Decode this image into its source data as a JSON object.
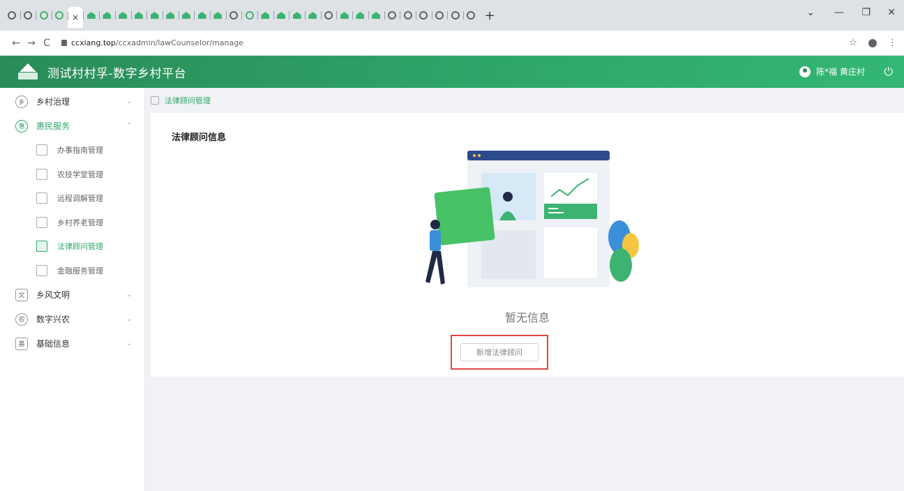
{
  "browser": {
    "tab_close": "×",
    "new_tab": "+",
    "url_host": "ccxiang.top",
    "url_path": "/ccxadmin/lawCounselor/manage",
    "nav_back": "←",
    "nav_forward": "→",
    "nav_reload": "C",
    "star": "☆",
    "menu": "⋮",
    "win_dropdown": "⌄",
    "win_min": "—",
    "win_restore": "❐",
    "win_close": "✕",
    "tabs": [
      "globe",
      "globe",
      "green",
      "green",
      "close",
      "house",
      "house",
      "house",
      "house",
      "house",
      "house",
      "house",
      "house",
      "house",
      "globe",
      "green",
      "house",
      "house",
      "house",
      "house",
      "globe",
      "house",
      "house",
      "house",
      "globe",
      "globe",
      "globe",
      "globe",
      "globe",
      "globe"
    ]
  },
  "header": {
    "title": "测试村村孚-数字乡村平台",
    "user_text": "陈*福 黄庄村",
    "power_icon": "power-icon"
  },
  "sidebar": {
    "items": [
      {
        "label": "乡村治理",
        "icon": "乡",
        "arrow": "⌄"
      },
      {
        "label": "惠民服务",
        "icon": "惠",
        "arrow": "⌃"
      }
    ],
    "sub_items": [
      {
        "label": "办事指南管理"
      },
      {
        "label": "农技学堂管理"
      },
      {
        "label": "远程调解管理"
      },
      {
        "label": "乡村养老管理"
      },
      {
        "label": "法律顾问管理"
      },
      {
        "label": "金融服务管理"
      }
    ],
    "items_after": [
      {
        "label": "乡风文明",
        "icon": "文",
        "arrow": "⌄"
      },
      {
        "label": "数字兴农",
        "icon": "农",
        "arrow": "⌄"
      },
      {
        "label": "基础信息",
        "icon": "基",
        "arrow": "⌄"
      }
    ]
  },
  "breadcrumb": {
    "label": "法律顾问管理"
  },
  "main": {
    "title": "法律顾问信息",
    "empty_text": "暂无信息",
    "add_button": "新增法律顾问"
  },
  "colors": {
    "accent": "#2fa86a",
    "header_start": "#2a8c59",
    "header_end": "#34b774",
    "highlight_border": "#e04444"
  }
}
